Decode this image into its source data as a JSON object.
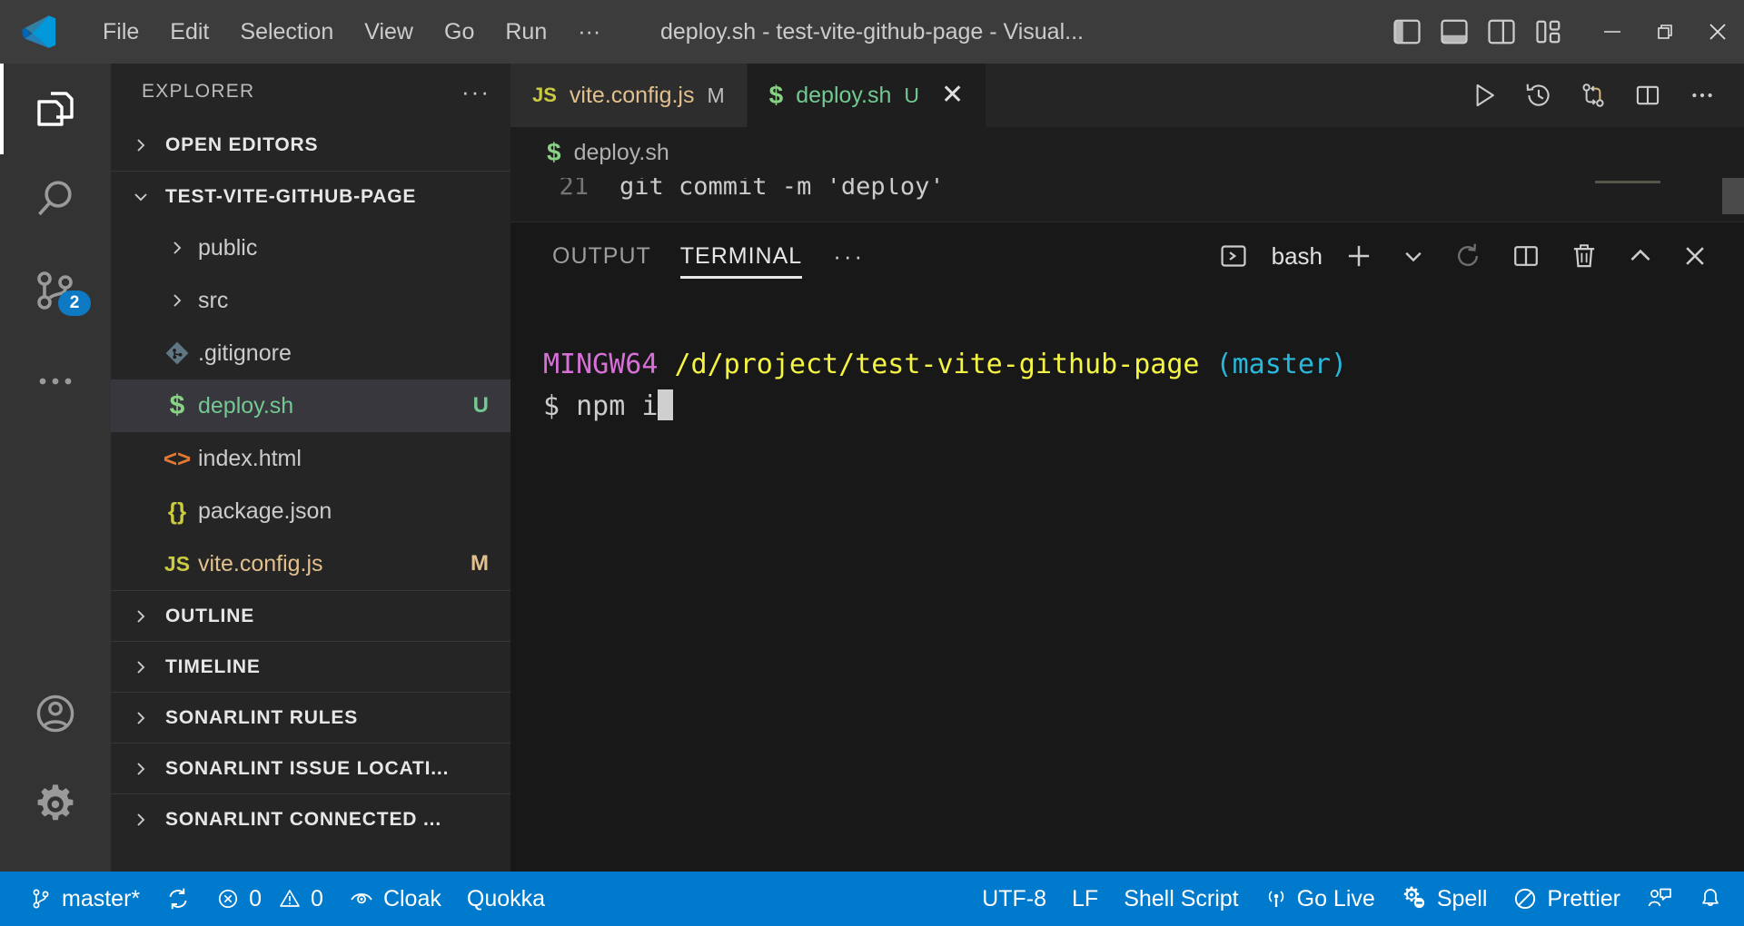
{
  "titlebar": {
    "logo_icon": "vscode-logo-icon",
    "menus": [
      "File",
      "Edit",
      "Selection",
      "View",
      "Go",
      "Run",
      "···"
    ],
    "title": "deploy.sh - test-vite-github-page - Visual...",
    "layout_buttons": [
      {
        "name": "toggle-primary-sidebar-icon",
        "label": "Toggle Primary Side Bar"
      },
      {
        "name": "toggle-panel-icon",
        "label": "Toggle Panel"
      },
      {
        "name": "toggle-secondary-sidebar-icon",
        "label": "Toggle Secondary Side Bar"
      },
      {
        "name": "customize-layout-icon",
        "label": "Customize Layout"
      }
    ],
    "window_controls": [
      {
        "name": "minimize-button",
        "glyph": "─"
      },
      {
        "name": "maximize-button",
        "glyph": "❐"
      },
      {
        "name": "close-button",
        "glyph": "✕"
      }
    ]
  },
  "activitybar": {
    "items": [
      {
        "name": "activitybar-explorer",
        "icon": "files-icon",
        "active": true,
        "badge": ""
      },
      {
        "name": "activitybar-search",
        "icon": "search-icon",
        "active": false,
        "badge": ""
      },
      {
        "name": "activitybar-source-control",
        "icon": "source-control-icon",
        "active": false,
        "badge": "2"
      },
      {
        "name": "activitybar-more",
        "icon": "more-horizontal-icon",
        "active": false,
        "badge": ""
      }
    ],
    "bottom_items": [
      {
        "name": "activitybar-accounts",
        "icon": "account-icon"
      },
      {
        "name": "activitybar-settings",
        "icon": "gear-icon"
      }
    ]
  },
  "sidebar": {
    "title": "EXPLORER",
    "more_actions": "···",
    "sections": [
      {
        "name": "open-editors",
        "label": "OPEN EDITORS",
        "expanded": false
      },
      {
        "name": "folder-root",
        "label": "TEST-VITE-GITHUB-PAGE",
        "expanded": true
      }
    ],
    "files": [
      {
        "name": "public",
        "label": "public",
        "type": "folder",
        "icon": "chevron-right-icon",
        "icon_color": "#cccccc",
        "badge": "",
        "badge_color": "",
        "text_color": "#cccccc",
        "selected": false
      },
      {
        "name": "src",
        "label": "src",
        "type": "folder",
        "icon": "chevron-right-icon",
        "icon_color": "#cccccc",
        "badge": "",
        "badge_color": "",
        "text_color": "#cccccc",
        "selected": false
      },
      {
        "name": "gitignore",
        "label": ".gitignore",
        "type": "file",
        "icon": "git-icon",
        "icon_color": "#8a9aa2",
        "badge": "",
        "badge_color": "",
        "text_color": "#cccccc",
        "selected": false
      },
      {
        "name": "deploy-sh",
        "label": "deploy.sh",
        "type": "file",
        "icon": "shell-icon",
        "icon_color": "#89d185",
        "badge": "U",
        "badge_color": "#73c991",
        "text_color": "#73c991",
        "selected": true
      },
      {
        "name": "index-html",
        "label": "index.html",
        "type": "file",
        "icon": "html-icon",
        "icon_color": "#e37933",
        "badge": "",
        "badge_color": "",
        "text_color": "#cccccc",
        "selected": false
      },
      {
        "name": "package-json",
        "label": "package.json",
        "type": "file",
        "icon": "json-icon",
        "icon_color": "#cbcb41",
        "badge": "",
        "badge_color": "",
        "text_color": "#cccccc",
        "selected": false
      },
      {
        "name": "vite-config-js",
        "label": "vite.config.js",
        "type": "file",
        "icon": "js-icon",
        "icon_color": "#cbcb41",
        "badge": "M",
        "badge_color": "#e2c08d",
        "text_color": "#e2c08d",
        "selected": false
      }
    ],
    "bottom_sections": [
      {
        "name": "outline",
        "label": "OUTLINE"
      },
      {
        "name": "timeline",
        "label": "TIMELINE"
      },
      {
        "name": "sonarlint-rules",
        "label": "SONARLINT RULES"
      },
      {
        "name": "sonarlint-issue-locations",
        "label": "SONARLINT ISSUE LOCATI..."
      },
      {
        "name": "sonarlint-connected-mode",
        "label": "SONARLINT CONNECTED ..."
      }
    ]
  },
  "editor": {
    "tabs": [
      {
        "name": "tab-vite-config-js",
        "label": "vite.config.js",
        "icon": "js-icon",
        "icon_color": "#cbcb41",
        "badge": "M",
        "text_color": "#e2c08d",
        "active": false,
        "closable": false
      },
      {
        "name": "tab-deploy-sh",
        "label": "deploy.sh",
        "icon": "shell-icon",
        "icon_color": "#89d185",
        "badge": "U",
        "text_color": "#73c991",
        "active": true,
        "closable": true
      }
    ],
    "close_glyph": "✕",
    "actions": [
      {
        "name": "run-script-icon",
        "label": "Run"
      },
      {
        "name": "timeline-history-icon",
        "label": "History"
      },
      {
        "name": "git-compare-icon",
        "label": "Compare"
      },
      {
        "name": "split-editor-icon",
        "label": "Split Editor"
      },
      {
        "name": "editor-more-actions-icon",
        "label": "···"
      }
    ],
    "breadcrumb": {
      "icon": "shell-icon",
      "label": "deploy.sh"
    },
    "visible_code_line": {
      "number": "21",
      "text": "git commit -m 'deploy'",
      "string_part": "'deploy'"
    }
  },
  "panel": {
    "tabs": [
      {
        "name": "panel-tab-output",
        "label": "OUTPUT",
        "active": false
      },
      {
        "name": "panel-tab-terminal",
        "label": "TERMINAL",
        "active": true
      }
    ],
    "more_glyph": "···",
    "shell_label": "bash",
    "actions": [
      {
        "name": "terminal-shell-selector-icon",
        "label": "bash"
      },
      {
        "name": "new-terminal-icon",
        "label": "New Terminal"
      },
      {
        "name": "terminal-dropdown-icon",
        "label": "Launch Profile"
      },
      {
        "name": "terminal-rerun-icon",
        "label": "Rerun"
      },
      {
        "name": "split-terminal-icon",
        "label": "Split Terminal"
      },
      {
        "name": "kill-terminal-icon",
        "label": "Kill Terminal"
      },
      {
        "name": "maximize-panel-icon",
        "label": "Maximize Panel"
      },
      {
        "name": "close-panel-icon",
        "label": "Close Panel"
      }
    ],
    "terminal": {
      "prompt_host": "MINGW64",
      "prompt_path": "/d/project/test-vite-github-page",
      "prompt_branch": "(master)",
      "command_prefix": "$",
      "command": "npm i",
      "colors": {
        "host": "#d670d6",
        "path": "#f5f543",
        "branch": "#29b8db",
        "text": "#cccccc"
      }
    }
  },
  "statusbar": {
    "background": "#007acc",
    "left": [
      {
        "name": "status-branch",
        "icon": "source-control-icon",
        "label": "master*"
      },
      {
        "name": "status-sync",
        "icon": "sync-icon",
        "label": ""
      },
      {
        "name": "status-problems",
        "icon": "error-icon",
        "label": "0",
        "icon2": "warning-icon",
        "label2": "0"
      },
      {
        "name": "status-cloak",
        "icon": "eye-icon",
        "label": "Cloak"
      },
      {
        "name": "status-quokka",
        "icon": "",
        "label": "Quokka"
      }
    ],
    "right": [
      {
        "name": "status-encoding",
        "icon": "",
        "label": "UTF-8"
      },
      {
        "name": "status-eol",
        "icon": "",
        "label": "LF"
      },
      {
        "name": "status-language-mode",
        "icon": "",
        "label": "Shell Script"
      },
      {
        "name": "status-go-live",
        "icon": "broadcast-icon",
        "label": "Go Live"
      },
      {
        "name": "status-spell",
        "icon": "spell-gear-icon",
        "label": "Spell"
      },
      {
        "name": "status-prettier",
        "icon": "prettier-block-icon",
        "label": "Prettier"
      },
      {
        "name": "status-live-share",
        "icon": "live-share-icon",
        "label": ""
      },
      {
        "name": "status-notifications",
        "icon": "bell-icon",
        "label": ""
      }
    ]
  }
}
